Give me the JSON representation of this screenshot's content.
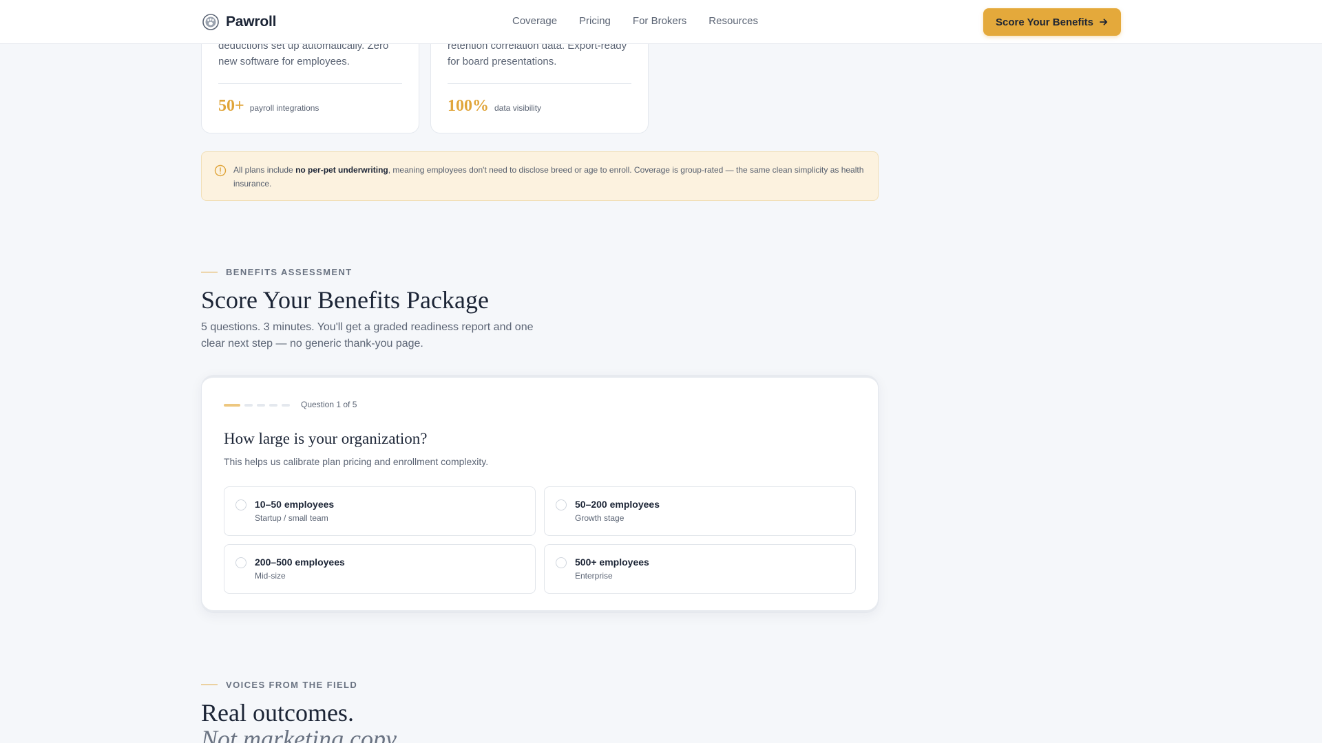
{
  "nav": {
    "brand": "Pawroll",
    "links": [
      "Coverage",
      "Pricing",
      "For Brokers",
      "Resources"
    ],
    "cta_label": "Score Your Benefits"
  },
  "features": [
    {
      "body": "deductions set up automatically. Zero new software for employees.",
      "stat": "50+",
      "stat_label": "payroll integrations"
    },
    {
      "body": "retention correlation data. Export-ready for board presentations.",
      "stat": "100%",
      "stat_label": "data visibility"
    }
  ],
  "notice": {
    "prefix": "All plans include ",
    "bold": "no per-pet underwriting",
    "suffix": ", meaning employees don't need to disclose breed or age to enroll. Coverage is group-rated — the same clean simplicity as health insurance."
  },
  "assessment": {
    "eyebrow": "BENEFITS ASSESSMENT",
    "title": "Score Your Benefits Package",
    "lead": "5 questions. 3 minutes. You'll get a graded readiness report and one clear next step — no generic thank-you page.",
    "progress_label": "Question 1 of 5",
    "progress": {
      "current": 1,
      "total": 5
    },
    "question": "How large is your organization?",
    "hint": "This helps us calibrate plan pricing and enrollment complexity.",
    "options": [
      {
        "title": "10–50 employees",
        "sub": "Startup / small team"
      },
      {
        "title": "50–200 employees",
        "sub": "Growth stage"
      },
      {
        "title": "200–500 employees",
        "sub": "Mid-size"
      },
      {
        "title": "500+ employees",
        "sub": "Enterprise"
      }
    ]
  },
  "voices": {
    "eyebrow": "VOICES FROM THE FIELD",
    "title": "Real outcomes.",
    "title_italic": "Not marketing copy."
  },
  "colors": {
    "accent": "#e4a93b",
    "notice_bg": "#fcf2df",
    "page_bg": "#f5f7fa"
  }
}
